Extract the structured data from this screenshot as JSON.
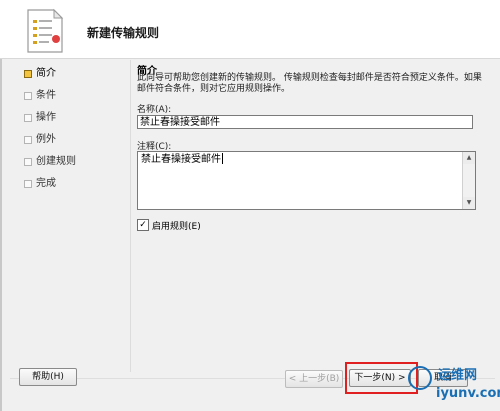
{
  "header": {
    "title": "新建传输规则",
    "icon": "document-wizard-icon"
  },
  "nav": {
    "items": [
      {
        "label": "简介",
        "active": true
      },
      {
        "label": "条件",
        "active": false
      },
      {
        "label": "操作",
        "active": false
      },
      {
        "label": "例外",
        "active": false
      },
      {
        "label": "创建规则",
        "active": false
      },
      {
        "label": "完成",
        "active": false
      }
    ]
  },
  "main": {
    "section_title": "简介",
    "description": "此向导可帮助您创建新的传输规则。 传输规则检查每封邮件是否符合预定义条件。如果邮件符合条件，则对它应用规则操作。",
    "name_label": "名称(A):",
    "name_value": "禁止春操接受邮件",
    "comment_label": "注释(C):",
    "comment_value": "禁止春操接受邮件",
    "enable_rule_label": "启用规则(E)",
    "enable_rule_checked": true
  },
  "footer": {
    "help_label": "帮助(H)",
    "back_label": "< 上一步(B)",
    "next_label": "下一步(N) >",
    "cancel_label": "取消"
  },
  "watermark": {
    "title": "运维网",
    "url": "iyunv.com"
  },
  "colors": {
    "accent": "#f2c440",
    "highlight": "#e02020",
    "watermark": "#1a6fb4"
  }
}
